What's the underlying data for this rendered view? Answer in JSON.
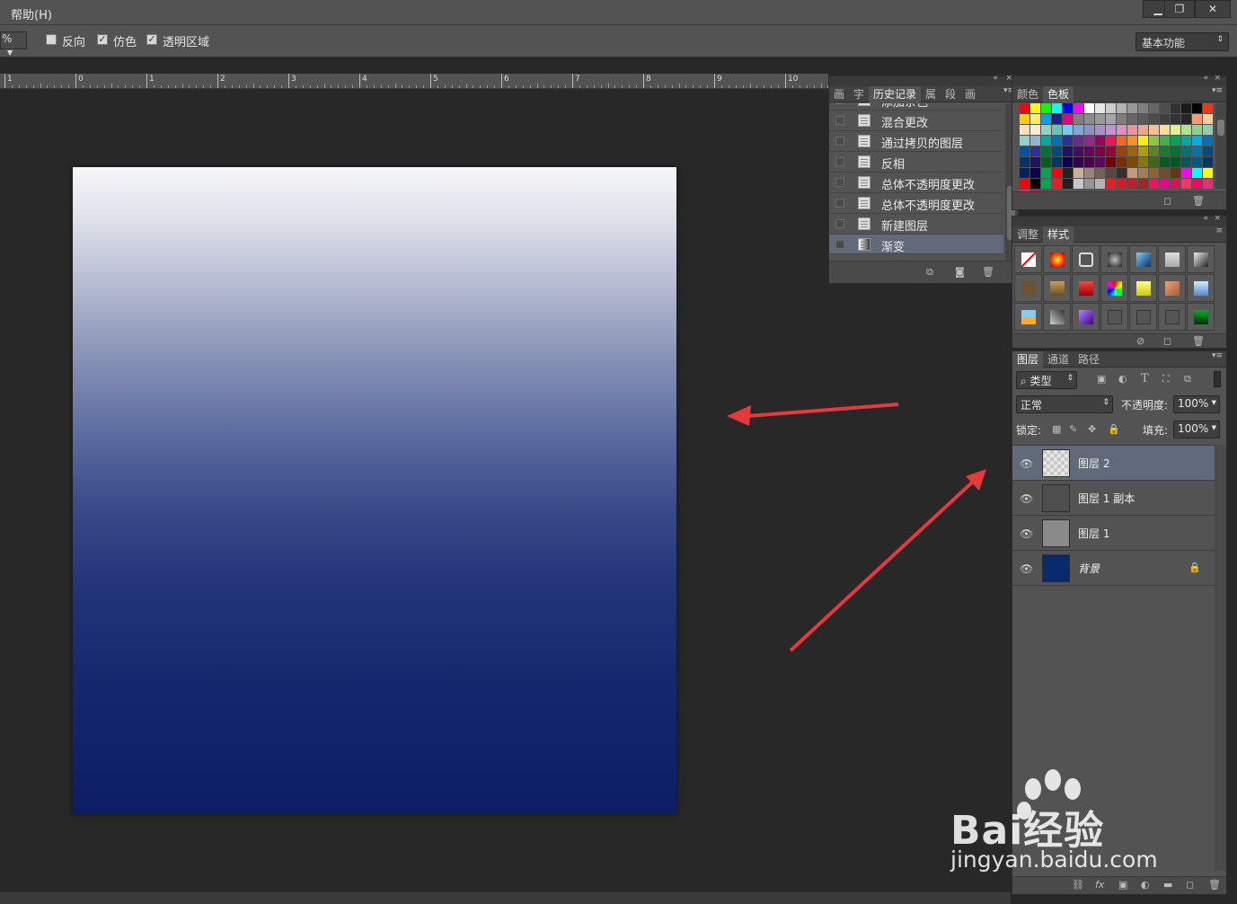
{
  "menu": {
    "help": "帮助(H)"
  },
  "window_controls": {
    "minimize": "▁",
    "restore": "❐",
    "close": "✕"
  },
  "options": {
    "percent_suffix": "%",
    "reverse": {
      "label": "反向",
      "checked": false
    },
    "dither": {
      "label": "仿色",
      "checked": true
    },
    "transparency": {
      "label": "透明区域",
      "checked": true
    },
    "workspace": "基本功能"
  },
  "ruler": {
    "numbers": [
      "1",
      "0",
      "1",
      "2",
      "3",
      "4",
      "5",
      "6",
      "7",
      "8",
      "9",
      "10"
    ]
  },
  "history_panel": {
    "tabs": [
      "画",
      "字",
      "历史记录",
      "属",
      "段",
      "画"
    ],
    "active_tab": "历史记录",
    "items": [
      "添加杂色",
      "混合更改",
      "通过拷贝的图层",
      "反相",
      "总体不透明度更改",
      "总体不透明度更改",
      "新建图层",
      "渐变"
    ]
  },
  "swatches_panel": {
    "tabs": [
      "颜色",
      "色板"
    ],
    "active_tab": "色板",
    "colors": [
      "#ff0000",
      "#ffff00",
      "#00ff00",
      "#00ffff",
      "#0000ff",
      "#ff00ff",
      "#ffffff",
      "#e6e6e6",
      "#cccccc",
      "#b3b3b3",
      "#999999",
      "#808080",
      "#666666",
      "#4d4d4d",
      "#333333",
      "#1a1a1a",
      "#000000",
      "#ff3300",
      "#ffcc00",
      "#ffee66",
      "#00a0e9",
      "#1d2088",
      "#e4007f",
      "#808080",
      "#8c8c8c",
      "#999999",
      "#a6a6a6",
      "#7f7f7f",
      "#666666",
      "#595959",
      "#4c4c4c",
      "#404040",
      "#333333",
      "#262626",
      "#ff9966",
      "#ffcc99",
      "#ffe0b3",
      "#fff0cc",
      "#8fd3c8",
      "#6cc3b6",
      "#6ecff6",
      "#7fa7d8",
      "#8f8fd0",
      "#a98fd0",
      "#c88fd0",
      "#e08fc0",
      "#f08f9f",
      "#f4a38c",
      "#f8c08c",
      "#fae08c",
      "#e0f08c",
      "#b3e08c",
      "#8fd08c",
      "#8fd0b0",
      "#8fd0d0",
      "#8fb3d0",
      "#00a99d",
      "#0072bc",
      "#2e3192",
      "#662d91",
      "#92278f",
      "#9e005d",
      "#ed145b",
      "#f26522",
      "#f7941d",
      "#fff200",
      "#8dc63f",
      "#39b54a",
      "#00a651",
      "#00a99d",
      "#00aeef",
      "#0072bc",
      "#0054a6",
      "#2e3192",
      "#007236",
      "#004a80",
      "#1b1464",
      "#440e62",
      "#630460",
      "#7b0046",
      "#9e0039",
      "#a0410d",
      "#a36209",
      "#aba000",
      "#598527",
      "#197b30",
      "#007236",
      "#00746b",
      "#0076a3",
      "#004b80",
      "#003471",
      "#1b1464",
      "#005e20",
      "#003663",
      "#0d004c",
      "#32004b",
      "#4b0049",
      "#630460",
      "#790000",
      "#7b2e00",
      "#7d4900",
      "#827b00",
      "#406618",
      "#005e20",
      "#005826",
      "#005952",
      "#005b7f",
      "#003663",
      "#00215e",
      "#0d004c",
      "#00a651",
      "#ff0000",
      "#222222",
      "#c7b299",
      "#998675",
      "#736357",
      "#534741",
      "#37302d",
      "#c69c6d",
      "#a67c52",
      "#8c6239",
      "#754c24",
      "#603913",
      "#ff00ff",
      "#00ffff",
      "#ffff00",
      "#ff0000",
      "#000000",
      "#00a651",
      "#ed1c24",
      "#231f20",
      "#c7c7c7",
      "#959595",
      "#b3b3b3",
      "#ed1c24",
      "#d71920",
      "#be1e2d",
      "#a1262a",
      "#ed145b",
      "#ec008c",
      "#d4145a",
      "#ff3366",
      "#ff0066",
      "#ee2a7b",
      "#ec1c73",
      "#e2005a"
    ]
  },
  "styles_panel": {
    "tabs": [
      "调整",
      "样式"
    ],
    "active_tab": "样式"
  },
  "layers_panel": {
    "tabs": [
      "图层",
      "通道",
      "路径"
    ],
    "active_tab": "图层",
    "filter_kind": "类型",
    "blend_mode": "正常",
    "opacity_label": "不透明度:",
    "opacity_value": "100%",
    "lock_label": "锁定:",
    "fill_label": "填充:",
    "fill_value": "100%",
    "layers": [
      {
        "name": "图层 2",
        "selected": true,
        "thumb": "checker"
      },
      {
        "name": "图层 1 副本",
        "selected": false,
        "thumb": "noise-dark"
      },
      {
        "name": "图层 1",
        "selected": false,
        "thumb": "noise-light"
      },
      {
        "name": "背景",
        "selected": false,
        "thumb": "navy",
        "locked": true
      }
    ],
    "footer_icons": [
      "link-icon",
      "fx-icon",
      "mask-icon",
      "adjustment-icon",
      "folder-icon",
      "new-layer-icon",
      "trash-icon"
    ]
  },
  "watermark": {
    "brand": "Bai经验",
    "url": "jingyan.baidu.com"
  },
  "colors": {
    "ui_bg": "#535353",
    "canvas_bg": "#282828",
    "gradient_top": "#f7f7f9",
    "gradient_bottom": "#0c1d66",
    "arrow": "#e8383a"
  }
}
